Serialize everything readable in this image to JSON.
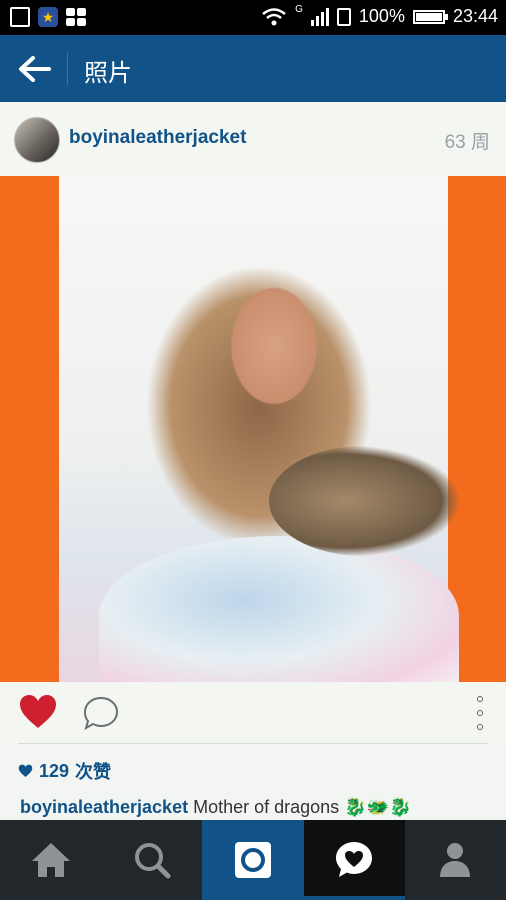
{
  "status_bar": {
    "battery": "100%",
    "battery_level": 1.0,
    "network": "G",
    "time": "23:44"
  },
  "app_bar": {
    "back_icon": "arrow-left-icon",
    "title": "照片"
  },
  "post": {
    "username": "boyinaleatherjacket",
    "time_ago": "63 周",
    "likes_count": "129",
    "likes_label": "次赞",
    "caption_user": "boyinaleatherjacket",
    "caption_text": " Mother of dragons ",
    "caption_emoji": "🐉🐲🐉",
    "liked": true
  },
  "bottom_nav": {
    "tabs": [
      "home-icon",
      "search-icon",
      "camera-icon",
      "activity-heart-icon",
      "profile-icon"
    ],
    "active": "activity-heart-icon"
  },
  "colors": {
    "brand": "#115388",
    "orange": "#f36c1e",
    "like": "#cf2030"
  }
}
